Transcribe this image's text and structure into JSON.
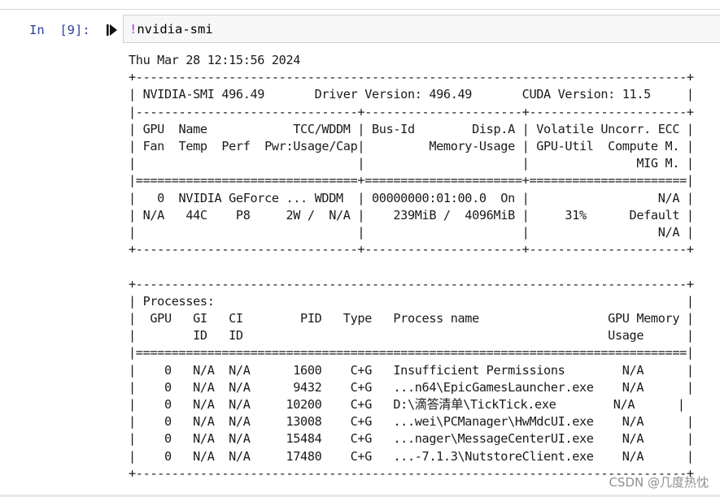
{
  "cell": {
    "prompt": "In  [9]:",
    "code_bang": "!",
    "code_rest": "nvidia-smi"
  },
  "output": {
    "lines": [
      "Thu Mar 28 12:15:56 2024",
      "+-----------------------------------------------------------------------------+",
      "| NVIDIA-SMI 496.49       Driver Version: 496.49       CUDA Version: 11.5     |",
      "|-------------------------------+----------------------+----------------------+",
      "| GPU  Name            TCC/WDDM | Bus-Id        Disp.A | Volatile Uncorr. ECC |",
      "| Fan  Temp  Perf  Pwr:Usage/Cap|         Memory-Usage | GPU-Util  Compute M. |",
      "|                               |                      |               MIG M. |",
      "|===============================+======================+======================|",
      "|   0  NVIDIA GeForce ... WDDM  | 00000000:01:00.0  On |                  N/A |",
      "| N/A   44C    P8     2W /  N/A |    239MiB /  4096MiB |     31%      Default |",
      "|                               |                      |                  N/A |",
      "+-------------------------------+----------------------+----------------------+",
      "",
      "+-----------------------------------------------------------------------------+",
      "| Processes:                                                                  |",
      "|  GPU   GI   CI        PID   Type   Process name                  GPU Memory |",
      "|        ID   ID                                                   Usage      |",
      "|=============================================================================|",
      "|    0   N/A  N/A      1600    C+G   Insufficient Permissions        N/A      |",
      "|    0   N/A  N/A      9432    C+G   ...n64\\EpicGamesLauncher.exe    N/A      |",
      "|    0   N/A  N/A     10200    C+G   D:\\滴答清单\\TickTick.exe        N/A      |",
      "|    0   N/A  N/A     13008    C+G   ...wei\\PCManager\\HwMdcUI.exe    N/A      |",
      "|    0   N/A  N/A     15484    C+G   ...nager\\MessageCenterUI.exe    N/A      |",
      "|    0   N/A  N/A     17480    C+G   ...-7.1.3\\NutstoreClient.exe    N/A      |",
      "+-----------------------------------------------------------------------------+"
    ]
  },
  "watermark": "CSDN @几度热忱"
}
